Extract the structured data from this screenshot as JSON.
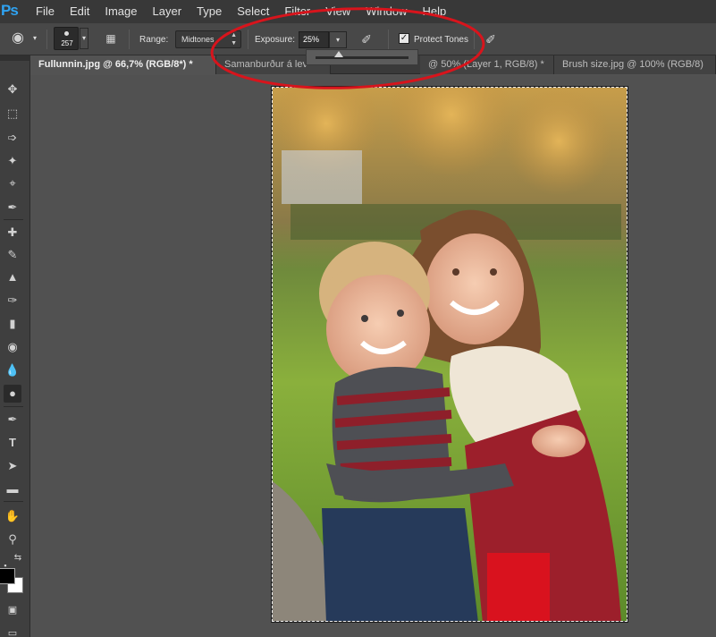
{
  "app": {
    "logo": "Ps",
    "menu": [
      "File",
      "Edit",
      "Image",
      "Layer",
      "Type",
      "Select",
      "Filter",
      "View",
      "Window",
      "Help"
    ]
  },
  "options": {
    "tool_icon": "dodge-tool-icon",
    "brush_size": "257",
    "range_label": "Range:",
    "range_value": "Midtones",
    "exposure_label": "Exposure:",
    "exposure_value": "25%",
    "exposure_slider_fraction": 0.25,
    "airbrush_icon": "airbrush-icon",
    "protect_tones_label": "Protect Tones",
    "protect_tones_checked": true,
    "pressure_icon": "pressure-size-icon"
  },
  "tabs": [
    {
      "label": "Fullunnin.jpg @ 66,7% (RGB/8*) *",
      "active": true
    },
    {
      "label": "Samanburður á lev",
      "active": false
    },
    {
      "label": "@ 50% (Layer 1, RGB/8) *",
      "active": false
    },
    {
      "label": "Brush size.jpg @ 100% (RGB/8)",
      "active": false
    }
  ],
  "colors": {
    "foreground": "#000000",
    "background": "#ffffff",
    "annotation": "#d8141c"
  }
}
